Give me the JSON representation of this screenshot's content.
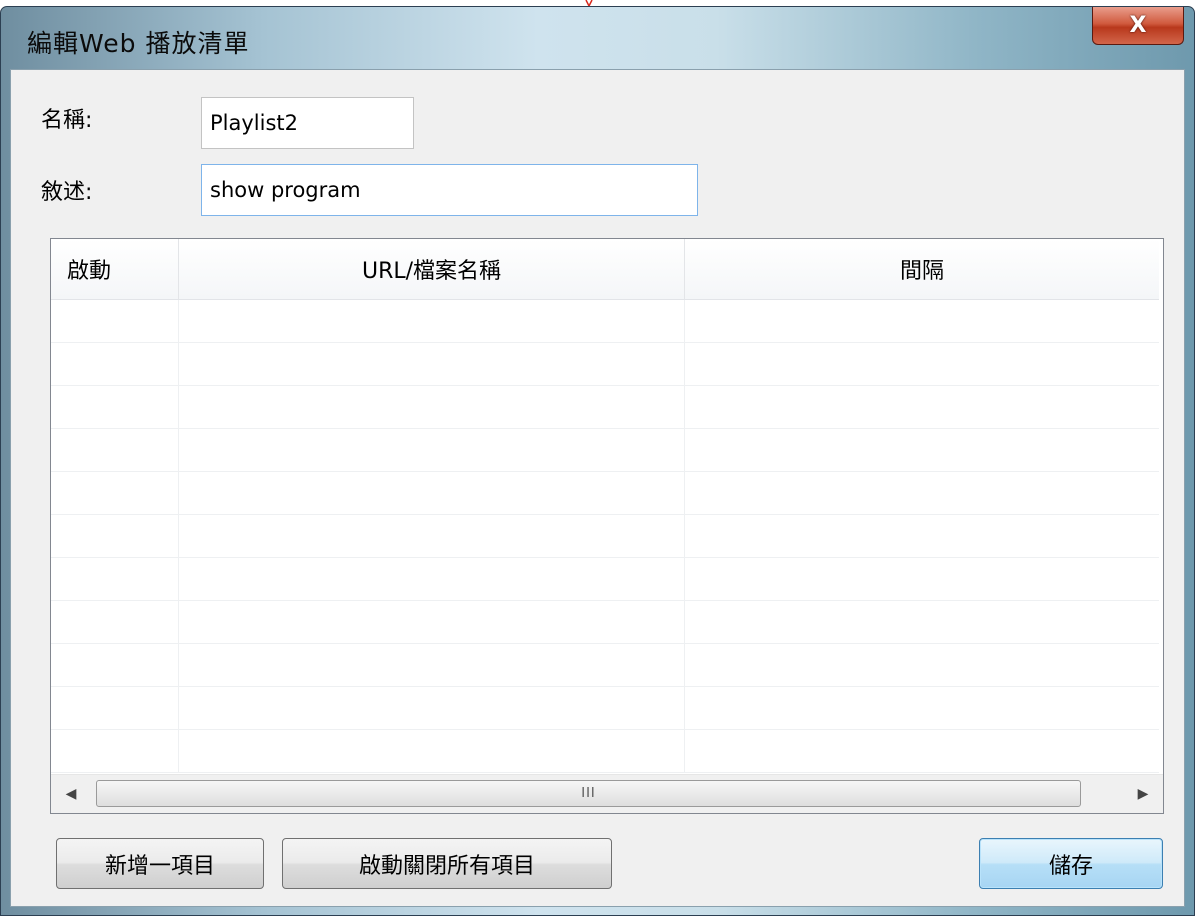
{
  "window": {
    "title": "編輯Web 播放清單",
    "close_label": "X"
  },
  "form": {
    "name_label": "名稱:",
    "name_value": "Playlist2",
    "description_label": "敘述:",
    "description_value": "show program"
  },
  "table": {
    "columns": [
      "啟動",
      "URL/檔案名稱",
      "間隔"
    ],
    "rows": [],
    "empty_row_count_visible": 11,
    "scrollbar_thumb_label": "III"
  },
  "buttons": {
    "add_item": "新增一項目",
    "toggle_all": "啟動關閉所有項目",
    "save": "儲存"
  },
  "colors": {
    "title_gradient_mid": "#cfe3ee",
    "close_button": "#c7492c",
    "default_button_border": "#3c7fb1"
  }
}
